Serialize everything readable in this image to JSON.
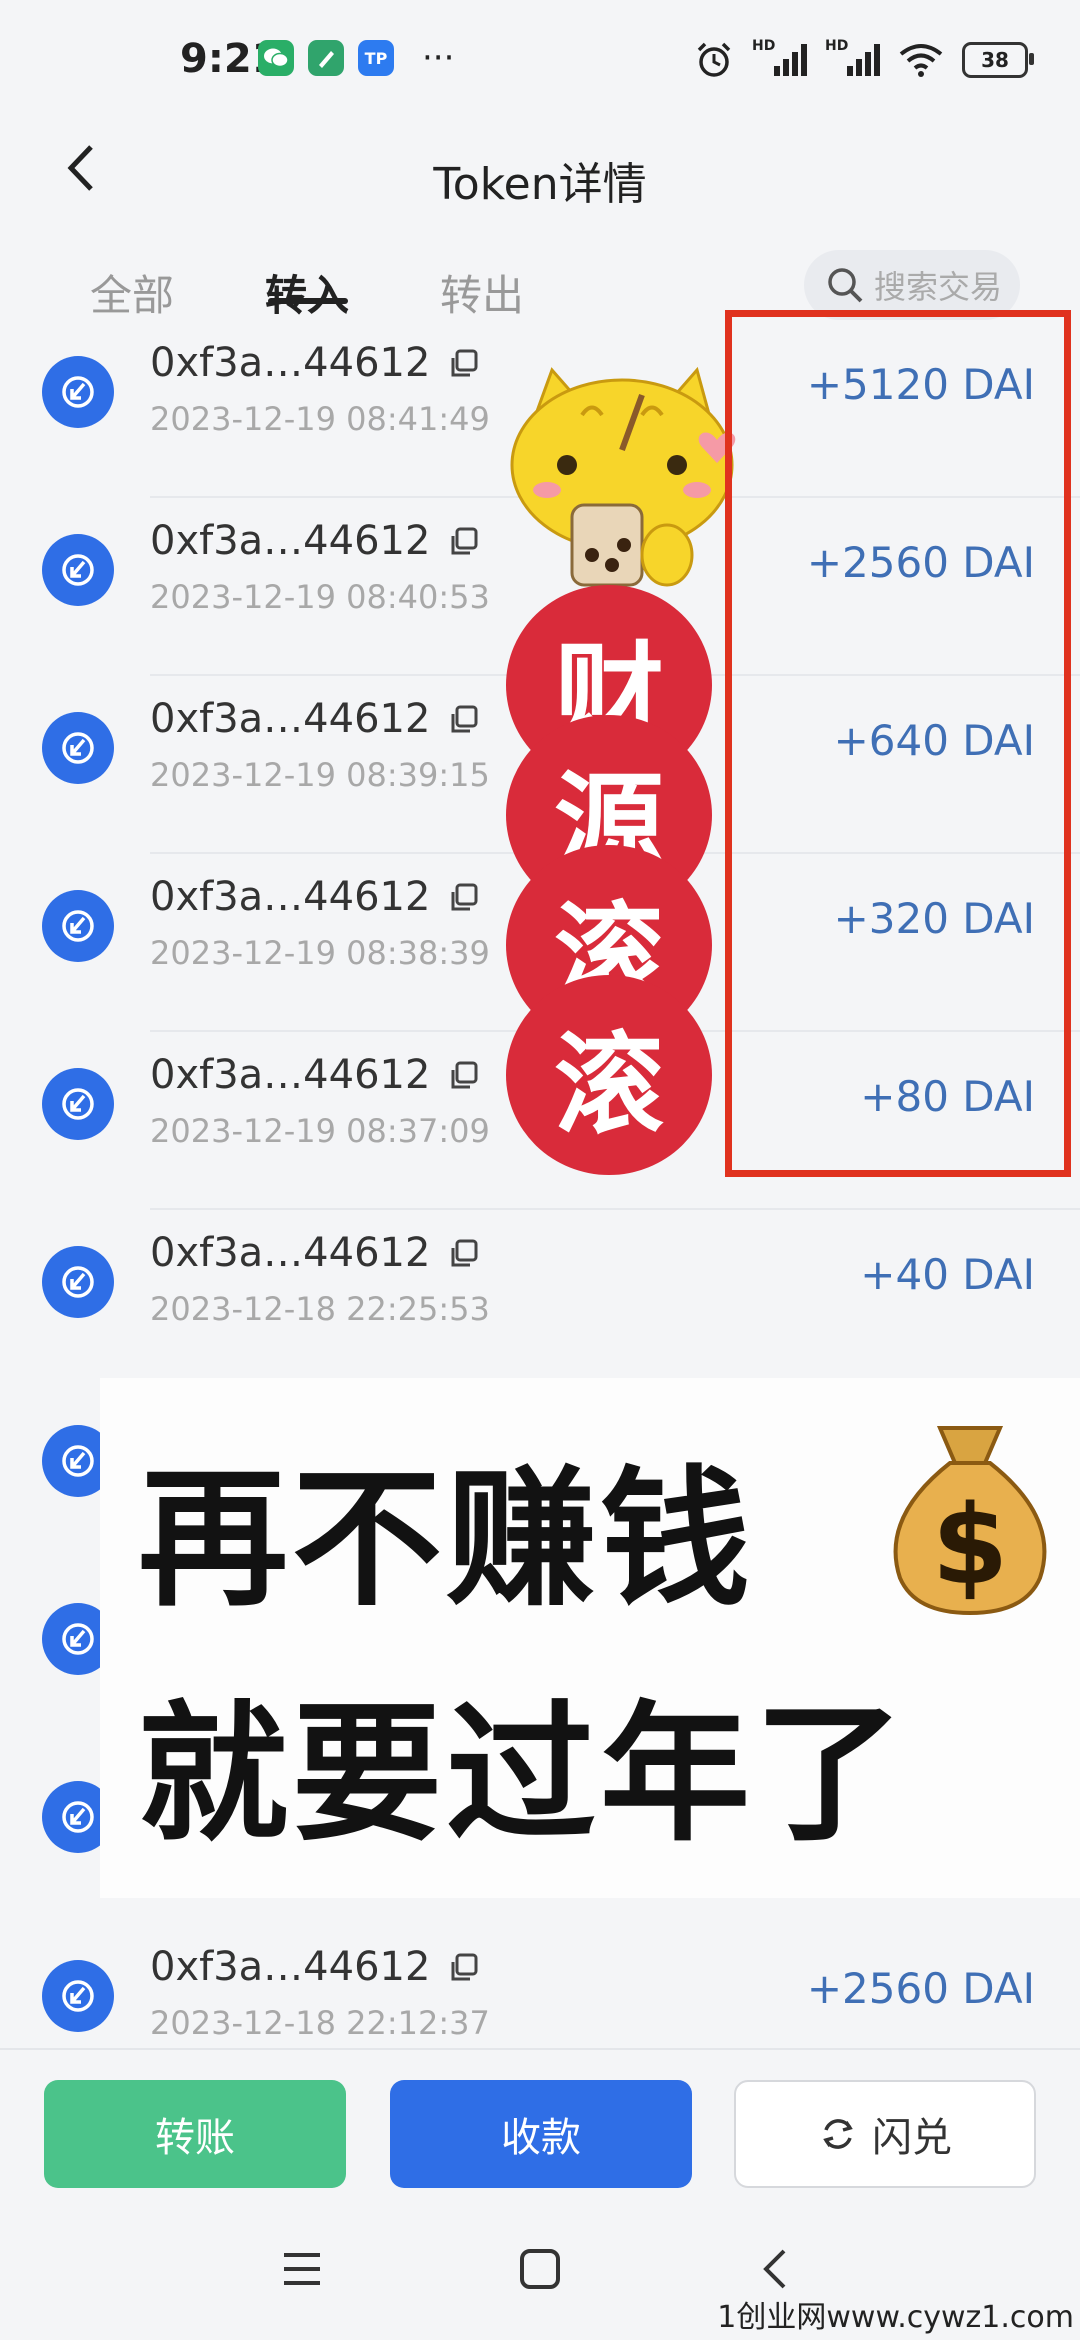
{
  "status_bar": {
    "time": "9:21",
    "apps": [
      "wechat-icon",
      "note-icon",
      "tp-wallet-icon"
    ],
    "app_tp_label": "TP",
    "more": "···",
    "signal_label": "HD",
    "battery": "38"
  },
  "header": {
    "title": "Token详情"
  },
  "tabs": [
    {
      "label": "全部",
      "active": false
    },
    {
      "label": "转入",
      "active": true
    },
    {
      "label": "转出",
      "active": false
    }
  ],
  "search": {
    "placeholder": "搜索交易"
  },
  "transactions": [
    {
      "address": "0xf3a…44612",
      "time": "2023-12-19 08:41:49",
      "amount": "+5120 DAI"
    },
    {
      "address": "0xf3a…44612",
      "time": "2023-12-19 08:40:53",
      "amount": "+2560 DAI"
    },
    {
      "address": "0xf3a…44612",
      "time": "2023-12-19 08:39:15",
      "amount": "+640 DAI"
    },
    {
      "address": "0xf3a…44612",
      "time": "2023-12-19 08:38:39",
      "amount": "+320 DAI"
    },
    {
      "address": "0xf3a…44612",
      "time": "2023-12-19 08:37:09",
      "amount": "+80 DAI"
    },
    {
      "address": "0xf3a…44612",
      "time": "2023-12-18 22:25:53",
      "amount": "+40 DAI"
    },
    {
      "address": "0xf3a…44612",
      "time": "2023-12-18 22:12:37",
      "amount": "+2560 DAI"
    }
  ],
  "sticker": {
    "chars": [
      "财",
      "源",
      "滚",
      "滚"
    ]
  },
  "meme": {
    "line1": "再不赚钱",
    "line2": "就要过年了",
    "emoji": "money-bag-icon",
    "bag_symbol": "$"
  },
  "actions": {
    "transfer": "转账",
    "receive": "收款",
    "swap": "闪兑"
  },
  "watermark": "1创业网www.cywz1.com",
  "colors": {
    "accent_blue": "#2f6ee6",
    "green": "#4bc38a",
    "amount_blue": "#3f6fb5",
    "frame_red": "#e0321e",
    "sticker_red": "#d92b3a"
  }
}
